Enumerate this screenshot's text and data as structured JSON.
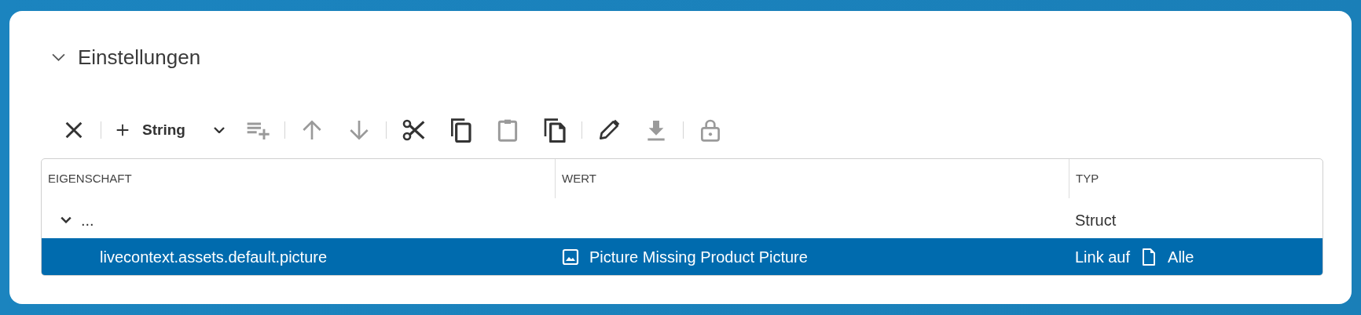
{
  "section": {
    "title": "Einstellungen",
    "expanded": true
  },
  "toolbar": [
    {
      "kind": "icon",
      "disabled": false
    },
    {
      "kind": "separator"
    },
    {
      "kind": "add",
      "label": "String",
      "disabled": false
    },
    {
      "kind": "icon",
      "disabled": true
    },
    {
      "kind": "separator"
    },
    {
      "kind": "icon",
      "disabled": true
    },
    {
      "kind": "icon",
      "disabled": true
    },
    {
      "kind": "separator"
    },
    {
      "kind": "icon",
      "disabled": false
    },
    {
      "kind": "icon",
      "disabled": false
    },
    {
      "kind": "icon",
      "disabled": true
    },
    {
      "kind": "icon",
      "disabled": false
    },
    {
      "kind": "separator"
    },
    {
      "kind": "icon",
      "disabled": false
    },
    {
      "kind": "icon",
      "disabled": true
    },
    {
      "kind": "separator"
    },
    {
      "kind": "icon",
      "disabled": true
    }
  ],
  "table": {
    "columns": [
      "EIGENSCHAFT",
      "WERT",
      "TYP"
    ],
    "rows": [
      {
        "property": "...",
        "value": "",
        "type": "Struct",
        "expanded": true,
        "selected": false,
        "children": [
          {
            "property": "livecontext.assets.default.picture",
            "value": "Picture Missing Product Picture",
            "type_prefix": "Link auf",
            "type": "Alle",
            "selected": true
          }
        ]
      }
    ]
  }
}
